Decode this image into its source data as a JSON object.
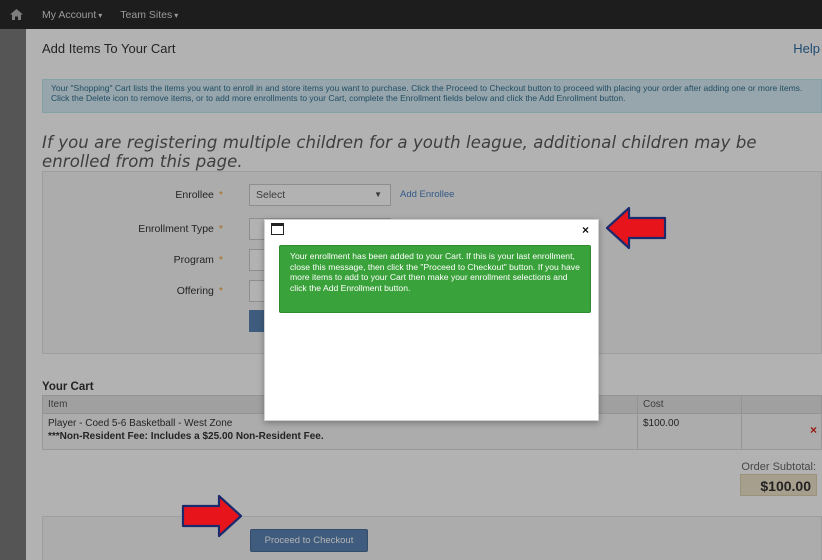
{
  "navbar": {
    "home_icon": "home-icon",
    "my_account": "My Account",
    "team_sites": "Team Sites"
  },
  "page": {
    "title": "Add Items To Your Cart",
    "help": "Help",
    "info": "Your \"Shopping\" Cart lists the items you want to enroll in and store items you want to purchase. Click the Proceed to Checkout button to proceed with placing your order after adding one or more items. Click the Delete icon to remove items, or to add more enrollments to your Cart, complete the Enrollment fields below and click the Add Enrollment button.",
    "youth_note": "If you are registering multiple children for a youth league, additional children may be enrolled from this page."
  },
  "form": {
    "enrollee_label": "Enrollee",
    "enrollee_value": "Select",
    "add_enrollee": "Add Enrollee",
    "enrollment_type_label": "Enrollment Type",
    "program_label": "Program",
    "offering_label": "Offering",
    "required_mark": "*"
  },
  "cart": {
    "title": "Your Cart",
    "headers": {
      "item": "Item",
      "cost": "Cost"
    },
    "rows": [
      {
        "item": "Player - Coed 5-6 Basketball - West Zone",
        "note": "***Non-Resident Fee: Includes a $25.00 Non-Resident Fee.",
        "cost": "$100.00",
        "delete": "×"
      }
    ],
    "subtotal_label": "Order Subtotal:",
    "subtotal_value": "$100.00",
    "checkout_label": "Proceed to Checkout"
  },
  "modal": {
    "window_icon": "window-icon",
    "close": "×",
    "message": "Your enrollment has been added to your Cart. If this is your last enrollment, close this message, then click the \"Proceed to Checkout\" button. If you have more items to add to your Cart then make your enrollment selections and click the Add Enrollment button."
  },
  "colors": {
    "alert_green": "#3aa23a",
    "primary_button": "#5b85b5",
    "arrow_red": "#e8141b",
    "arrow_outline": "#1a2a6c",
    "navbar": "#2a2a2a"
  }
}
